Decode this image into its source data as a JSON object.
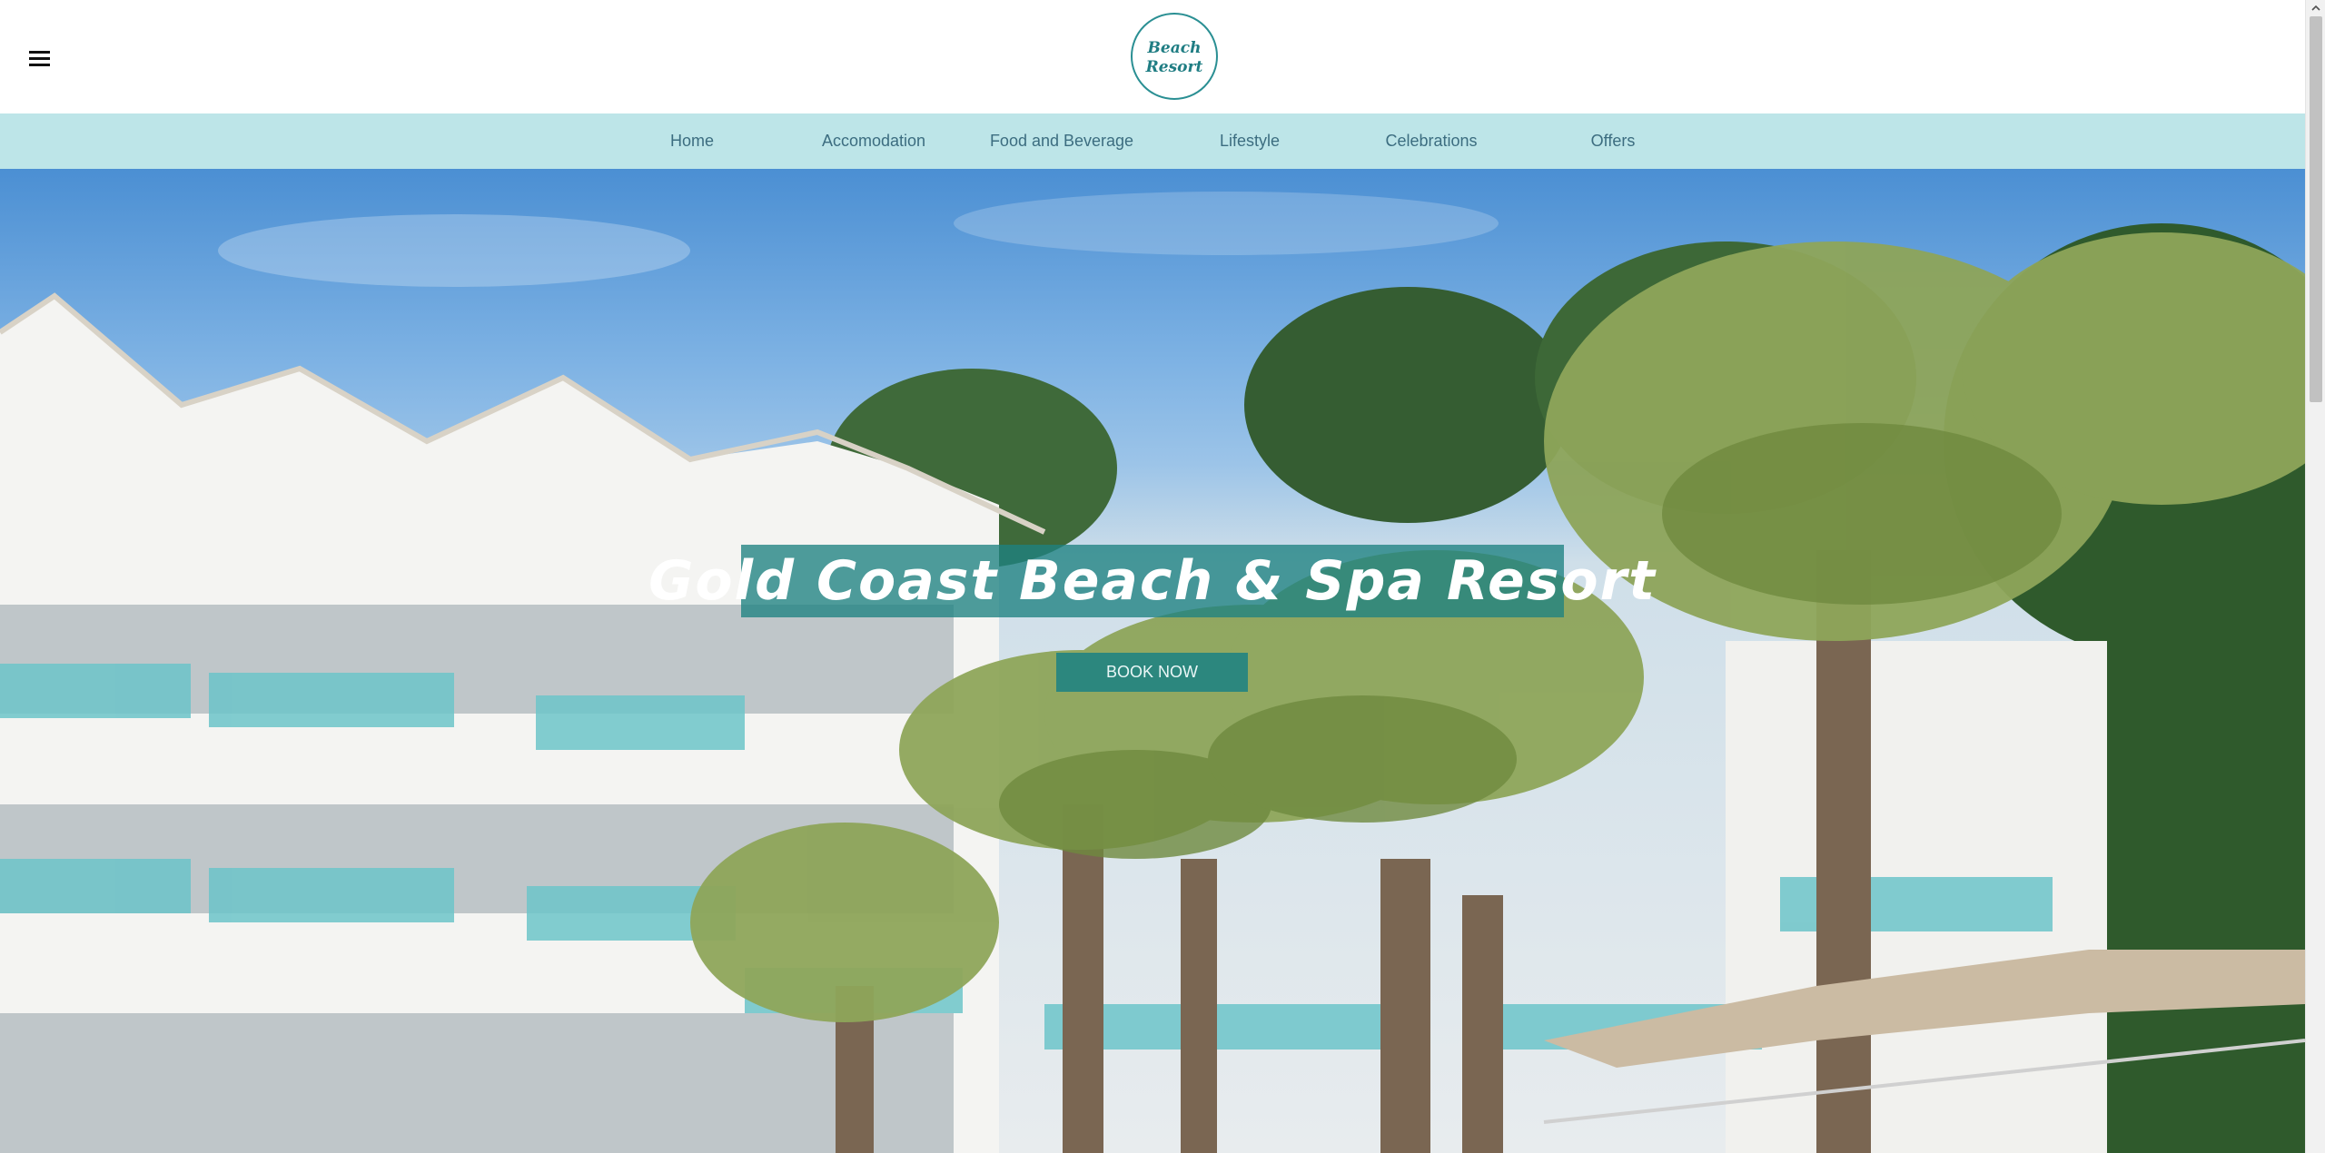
{
  "header": {
    "menu_icon": "hamburger-menu-icon",
    "logo": {
      "line1": "Beach",
      "line2": "Resort",
      "color": "#2a8f93"
    }
  },
  "nav": {
    "background": "#bde5e8",
    "items": [
      {
        "label": "Home"
      },
      {
        "label": "Accomodation"
      },
      {
        "label": "Food and Beverage"
      },
      {
        "label": "Lifestyle"
      },
      {
        "label": "Celebrations"
      },
      {
        "label": "Offers"
      }
    ]
  },
  "hero": {
    "title": "Gold Coast Beach & Spa Resort",
    "cta_label": "BOOK NOW",
    "accent": "#1e8282"
  },
  "scrollbar": {
    "up_icon": "chevron-up-icon"
  }
}
